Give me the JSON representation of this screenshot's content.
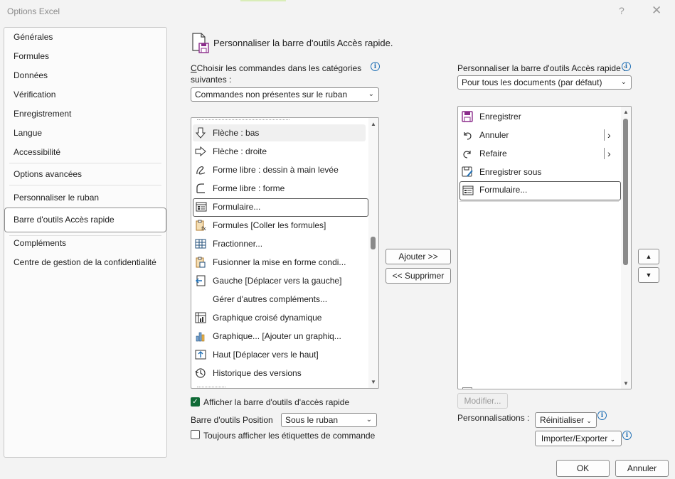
{
  "window": {
    "title": "Options Excel",
    "help": "?",
    "close": "✕"
  },
  "nav": {
    "items": [
      "Générales",
      "Formules",
      "Données",
      "Vérification",
      "Enregistrement",
      "Langue",
      "Accessibilité",
      "Options avancées",
      "Personnaliser le ruban",
      "Barre d'outils Accès rapide",
      "Compléments",
      "Centre de gestion de la confidentialité"
    ],
    "selected": "Barre d'outils Accès rapide"
  },
  "header": {
    "title": "Personnaliser la barre d'outils Accès rapide."
  },
  "left": {
    "choose_label_line1": "Choisir les commandes dans les catégories",
    "choose_label_line2": "suivantes :",
    "category_value": "Commandes non présentes sur le ruban",
    "commands": [
      "Flèche : bas",
      "Flèche : droite",
      "Forme libre : dessin à main levée",
      "Forme libre : forme",
      "Formulaire...",
      "Formules [Coller les formules]",
      "Fractionner...",
      "Fusionner la mise en forme condi...",
      "Gauche [Déplacer vers la gauche]",
      "Gérer d'autres compléments...",
      "Graphique croisé dynamique",
      "Graphique... [Ajouter un graphiq...",
      "Haut [Déplacer vers le haut]",
      "Historique des versions"
    ],
    "selected_command": "Formulaire..."
  },
  "middle": {
    "add_label": "Ajouter >>",
    "remove_label": "<< Supprimer"
  },
  "right": {
    "customize_label": "Personnaliser la barre d'outils Accès rapide :",
    "scope_value": "Pour tous les documents (par défaut)",
    "items": [
      "Enregistrer",
      "Annuler",
      "Refaire",
      "Enregistrer sous",
      "Formulaire..."
    ],
    "selected_item": "Formulaire...",
    "submenu_glyph": "›",
    "modify_label": "Modifier...",
    "personalizations_label": "Personnalisations :",
    "reset_label": "Réinitialiser",
    "import_export_label": "Importer/Exporter",
    "up": "▲",
    "down": "▼"
  },
  "bottom": {
    "show_toolbar_label": "Afficher la barre d'outils d'accès rapide",
    "show_toolbar_checked": true,
    "position_label": "Barre d'outils Position",
    "position_value": "Sous le ruban",
    "always_labels": "Toujours afficher les étiquettes de commande",
    "always_labels_checked": false
  },
  "footer": {
    "ok_label": "OK",
    "cancel_label": "Annuler"
  },
  "colors": {
    "accent_green": "#0f6a36",
    "info_blue": "#1f6fb5",
    "save_purple": "#8b2d8b"
  }
}
